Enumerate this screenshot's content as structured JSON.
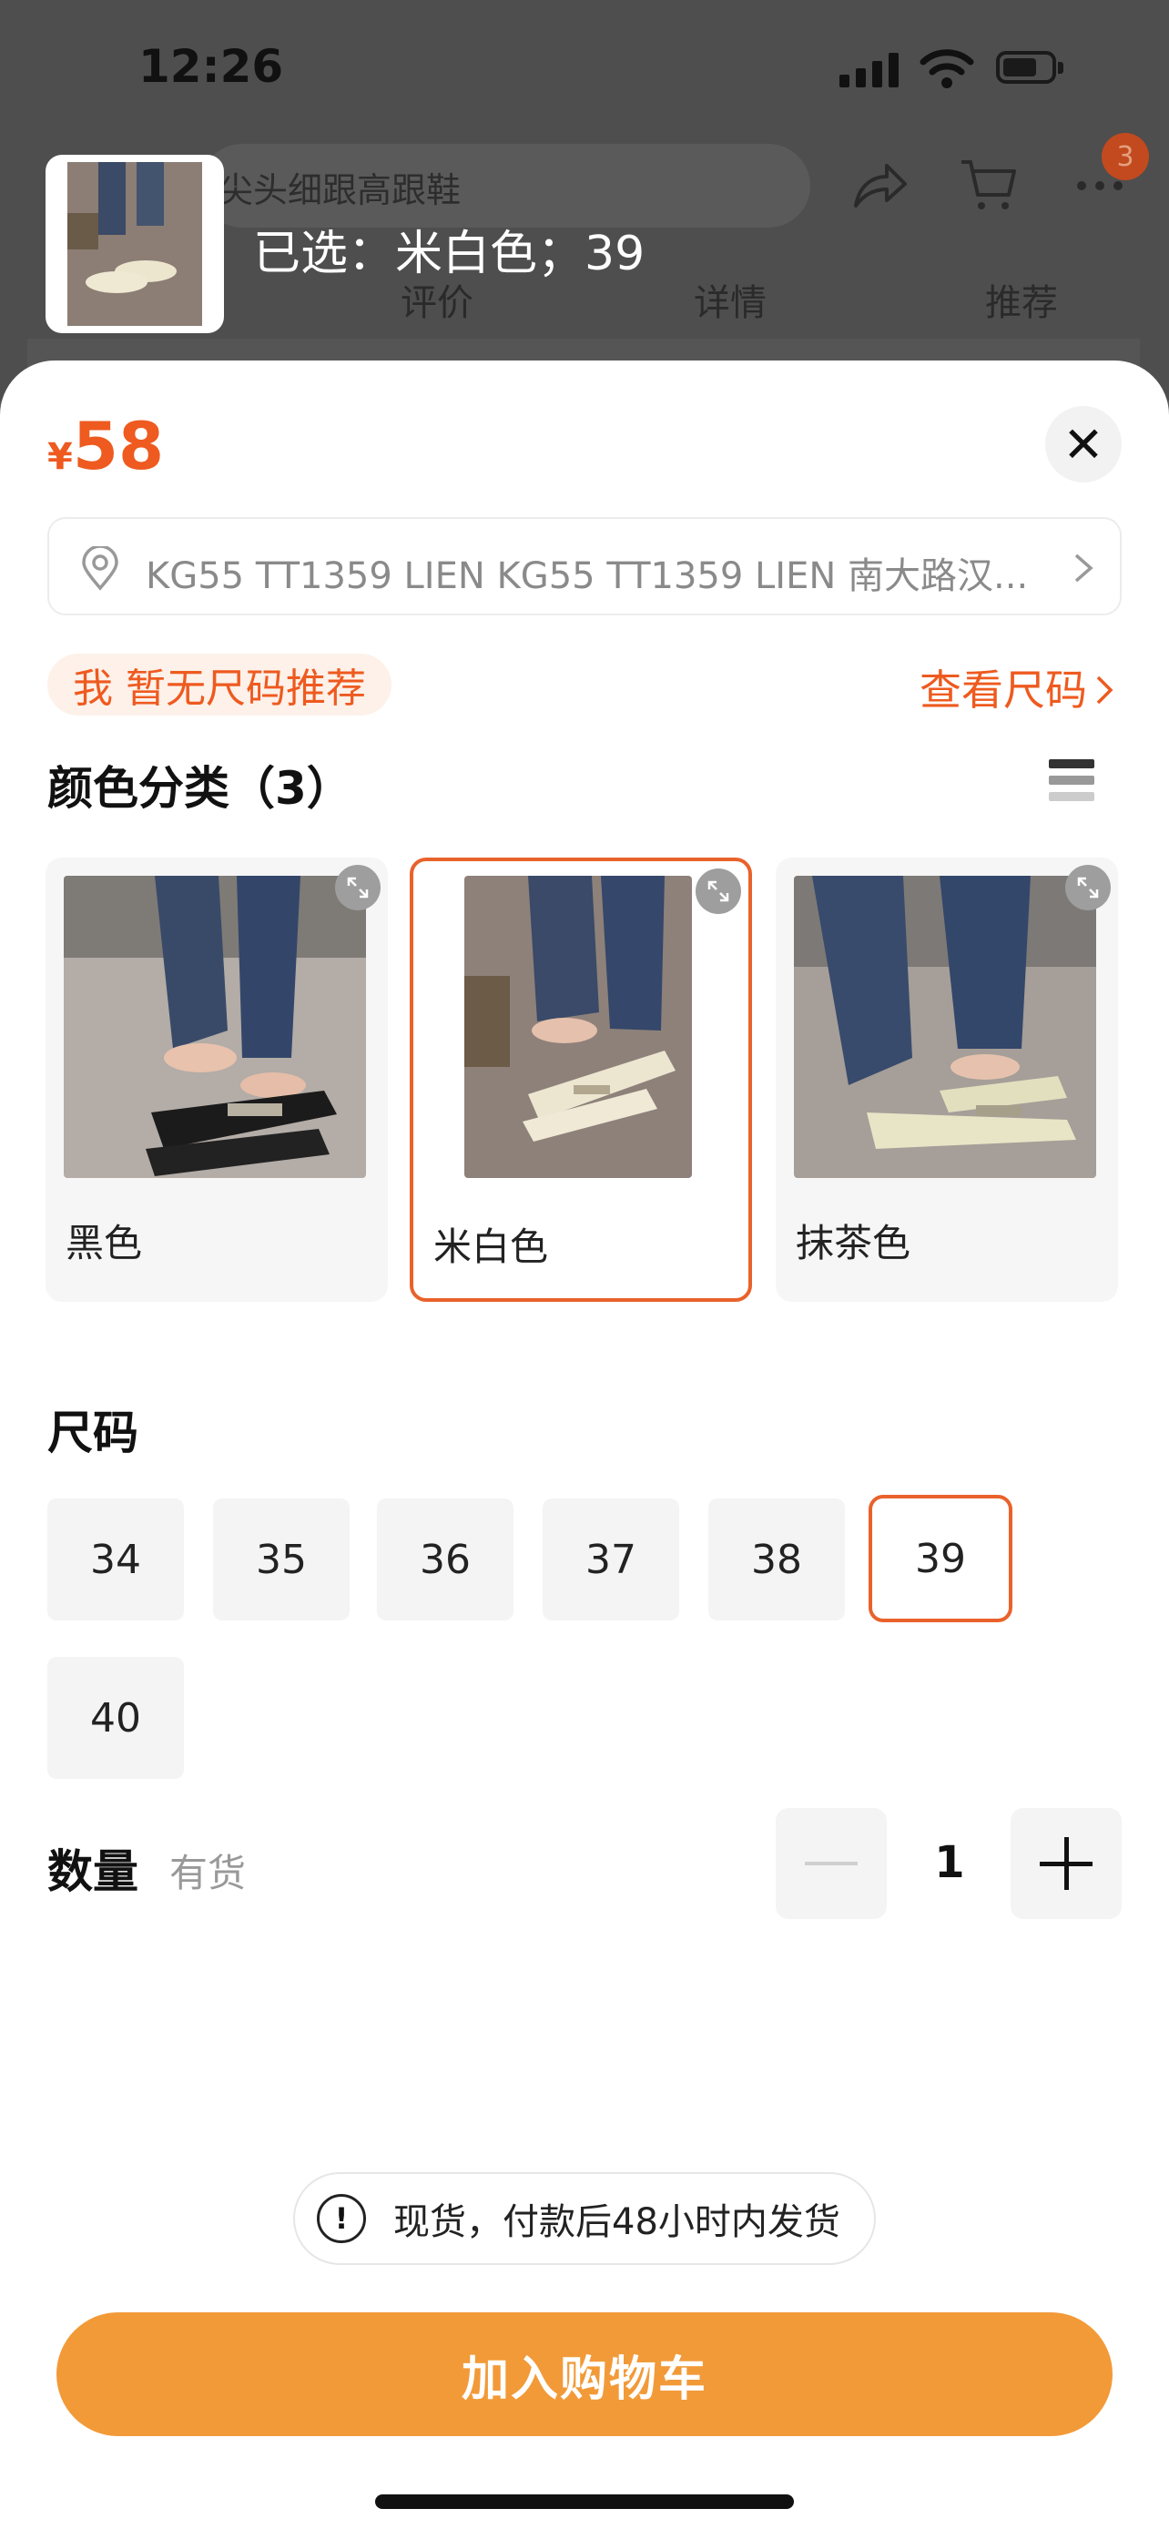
{
  "status_bar": {
    "time": "12:26"
  },
  "background_page": {
    "search_text": "尖头细跟高跟鞋",
    "cart_badge": "3",
    "tabs": [
      "评价",
      "详情",
      "推荐"
    ]
  },
  "selection": {
    "text": "已选：米白色；39"
  },
  "price": {
    "currency": "¥",
    "value": "58"
  },
  "address": {
    "text": "KG55 TT1359 LIEN KG55 TT1359 LIEN 南大路汉..."
  },
  "size_recommend": {
    "text": "我 暂无尺码推荐",
    "guide_label": "查看尺码"
  },
  "colors": {
    "title": "颜色分类（3）",
    "items": [
      {
        "label": "黑色",
        "selected": false
      },
      {
        "label": "米白色",
        "selected": true
      },
      {
        "label": "抹茶色",
        "selected": false
      }
    ]
  },
  "sizes": {
    "title": "尺码",
    "items": [
      "34",
      "35",
      "36",
      "37",
      "38",
      "39",
      "40"
    ],
    "selected": "39"
  },
  "quantity": {
    "title": "数量",
    "stock": "有货",
    "value": "1"
  },
  "notice": {
    "text": "现货，付款后48小时内发货"
  },
  "add_to_cart": {
    "label": "加入购物车"
  },
  "colors_palette": {
    "accent": "#ee5a1f",
    "button": "#f29a38"
  }
}
